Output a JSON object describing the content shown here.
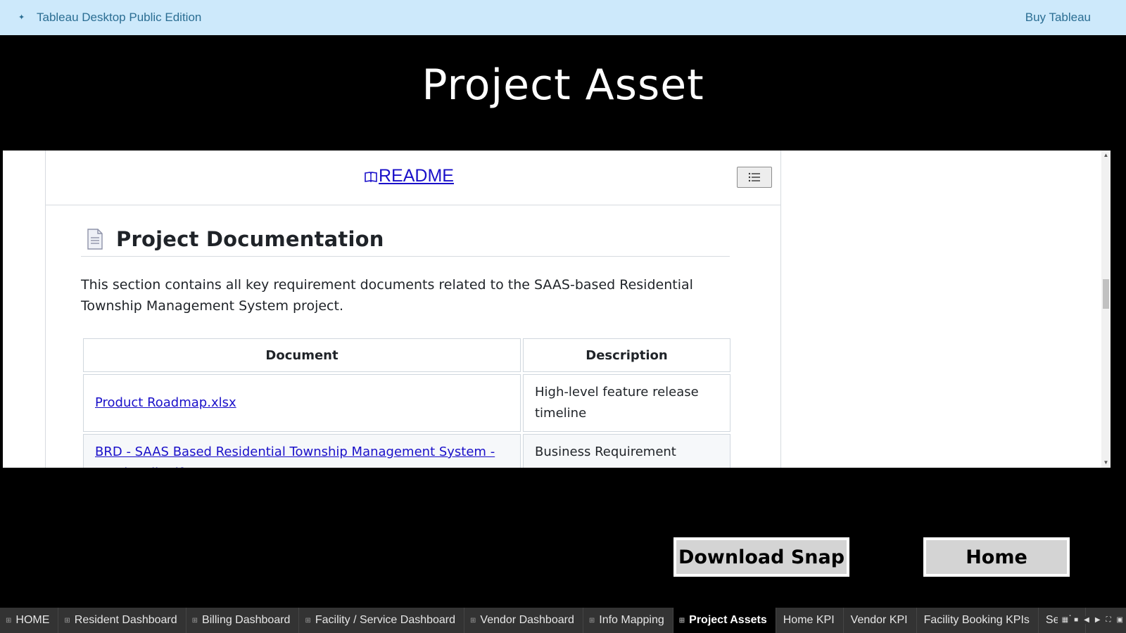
{
  "topbar": {
    "product_title": "Tableau Desktop Public Edition",
    "buy_link": "Buy Tableau",
    "logo_icon": "tableau-logo-icon"
  },
  "page": {
    "title": "Project Asset"
  },
  "readme": {
    "link_label": "README",
    "book_icon": "book-icon",
    "toc_icon": "list-icon",
    "heading": "Project Documentation",
    "heading_icon": "document-icon",
    "intro": "This section contains all key requirement documents related to the SAAS-based Residential Township Management System project.",
    "table": {
      "headers": [
        "Document",
        "Description"
      ],
      "rows": [
        {
          "document": "Product Roadmap.xlsx",
          "description": "High-level feature release timeline"
        },
        {
          "document": "BRD - SAAS Based Residential Township Management System - Suraj Patil.pdf",
          "description": "Business Requirement Document"
        }
      ]
    }
  },
  "actions": {
    "download_label": "Download Snap",
    "home_label": "Home"
  },
  "tabs": [
    {
      "label": "HOME",
      "active": false
    },
    {
      "label": "Resident Dashboard",
      "active": false
    },
    {
      "label": "Billing Dashboard",
      "active": false
    },
    {
      "label": "Facility / Service Dashboard",
      "active": false
    },
    {
      "label": "Vendor Dashboard",
      "active": false
    },
    {
      "label": "Info Mapping",
      "active": false
    },
    {
      "label": "Project Assets",
      "active": true
    },
    {
      "label": "Home KPI",
      "active": false
    },
    {
      "label": "Vendor KPI",
      "active": false
    },
    {
      "label": "Facility Booking KPIs",
      "active": false
    },
    {
      "label": "Servic",
      "active": false
    }
  ],
  "colors": {
    "topbar_bg": "#cde9fb",
    "topbar_text": "#2b6e93",
    "link": "#1a10c9",
    "page_bg": "#000000",
    "tabbar_bg": "#333333"
  }
}
